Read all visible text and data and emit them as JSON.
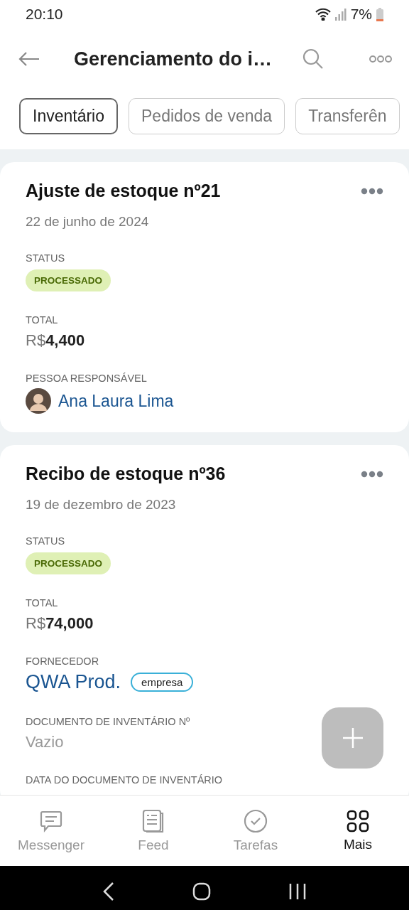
{
  "status_bar": {
    "time": "20:10",
    "battery": "7%"
  },
  "header": {
    "title": "Gerenciamento do i…"
  },
  "tabs": [
    {
      "label": "Inventário",
      "selected": true
    },
    {
      "label": "Pedidos de venda",
      "selected": false
    },
    {
      "label": "Transferên",
      "selected": false
    }
  ],
  "cards": [
    {
      "title": "Ajuste de estoque nº21",
      "date": "22 de junho de 2024",
      "fields": [
        {
          "kind": "badge",
          "label": "STATUS",
          "value": "PROCESSADO"
        },
        {
          "kind": "money",
          "label": "TOTAL",
          "currency": "R$",
          "amount": "4,400"
        },
        {
          "kind": "person",
          "label": "PESSOA RESPONSÁVEL",
          "value": "Ana Laura Lima"
        }
      ]
    },
    {
      "title": "Recibo de estoque nº36",
      "date": "19 de dezembro de 2023",
      "fields": [
        {
          "kind": "badge",
          "label": "STATUS",
          "value": "PROCESSADO"
        },
        {
          "kind": "money",
          "label": "TOTAL",
          "currency": "R$",
          "amount": "74,000"
        },
        {
          "kind": "company",
          "label": "FORNECEDOR",
          "value": "QWA Prod.",
          "tag": "empresa"
        },
        {
          "kind": "empty",
          "label": "DOCUMENTO DE INVENTÁRIO Nº",
          "placeholder": "Vazio"
        },
        {
          "kind": "label",
          "label": "DATA DO DOCUMENTO DE INVENTÁRIO"
        }
      ]
    }
  ],
  "bottom_nav": [
    {
      "label": "Messenger",
      "kind": "chat",
      "selected": false
    },
    {
      "label": "Feed",
      "kind": "feed",
      "selected": false
    },
    {
      "label": "Tarefas",
      "kind": "check",
      "selected": false
    },
    {
      "label": "Mais",
      "kind": "grid",
      "selected": true
    }
  ]
}
